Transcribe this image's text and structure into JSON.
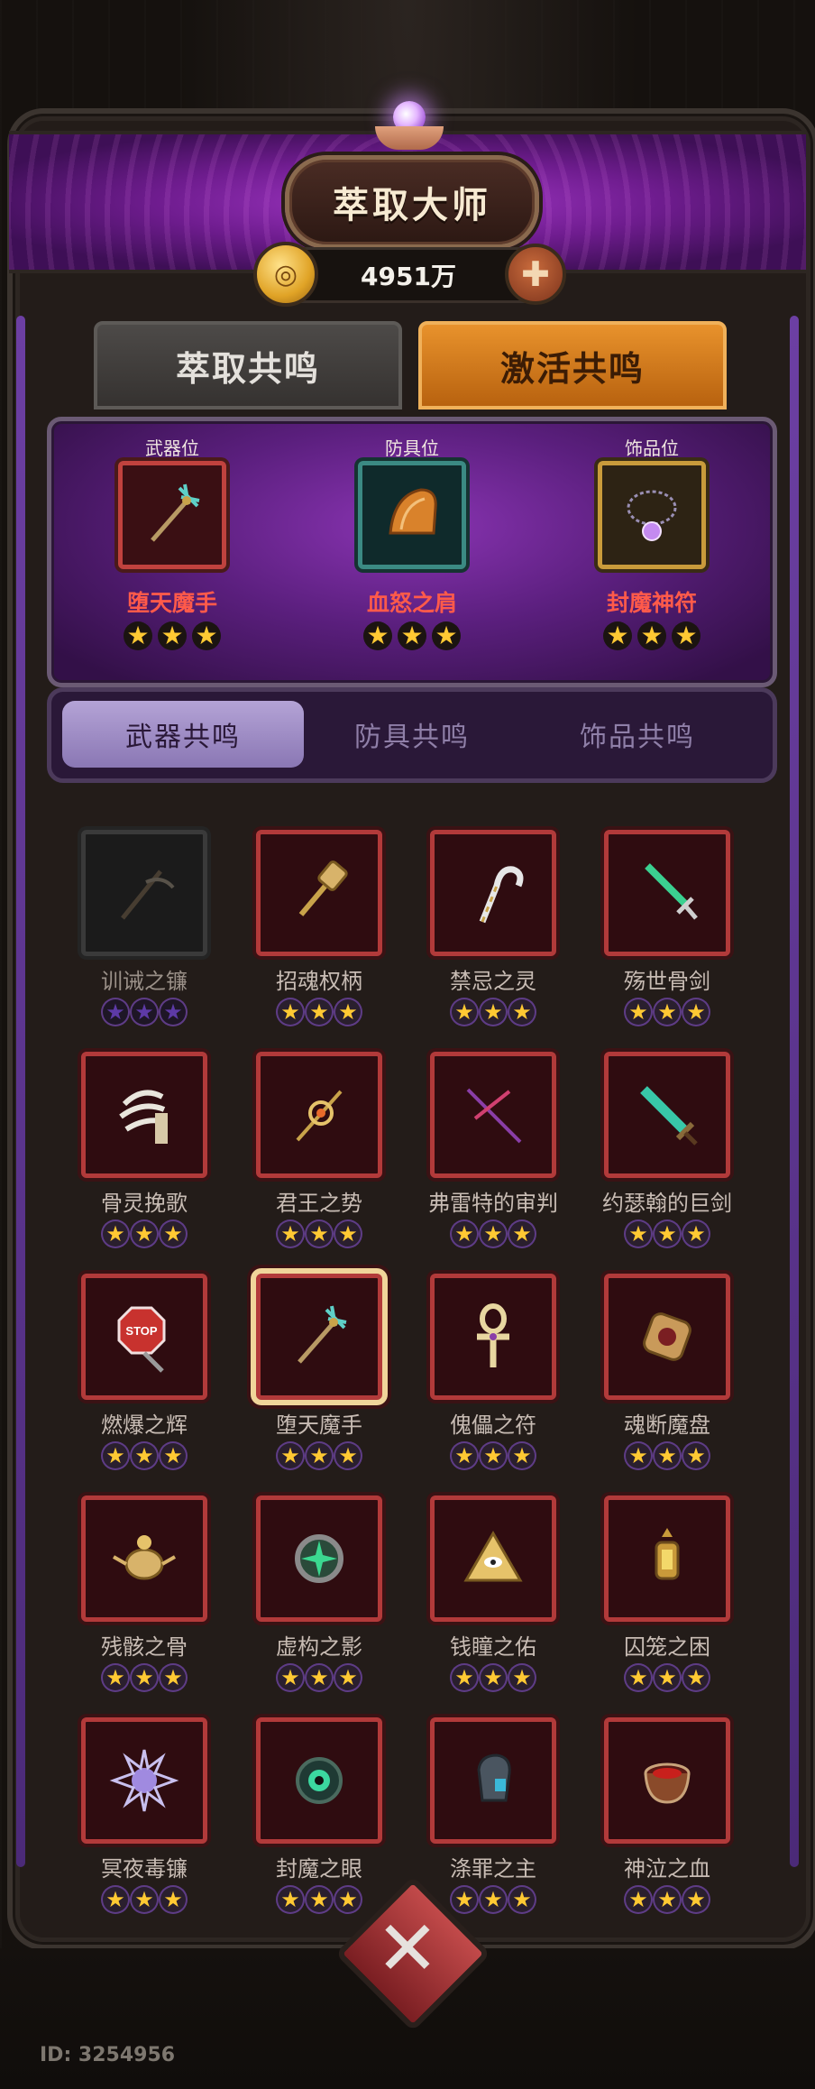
{
  "header": {
    "title": "萃取大师",
    "currency_amount": "4951万",
    "coin_icon": "coin-icon",
    "plus_icon": "plus-icon"
  },
  "main_tabs": [
    {
      "label": "萃取共鸣",
      "active": false
    },
    {
      "label": "激活共鸣",
      "active": true
    }
  ],
  "equipped": [
    {
      "slot_label": "武器位",
      "name": "堕天魔手",
      "stars": 3,
      "frame": "red",
      "icon": "trident-staff-icon"
    },
    {
      "slot_label": "防具位",
      "name": "血怒之肩",
      "stars": 3,
      "frame": "teal",
      "icon": "shoulder-armor-icon"
    },
    {
      "slot_label": "饰品位",
      "name": "封魔神符",
      "stars": 3,
      "frame": "gold",
      "icon": "amulet-icon"
    }
  ],
  "sub_tabs": [
    {
      "label": "武器共鸣",
      "active": true
    },
    {
      "label": "防具共鸣",
      "active": false
    },
    {
      "label": "饰品共鸣",
      "active": false
    }
  ],
  "weapons": [
    {
      "name": "训诫之镰",
      "stars": 3,
      "locked": true,
      "icon": "scythe-icon"
    },
    {
      "name": "招魂权柄",
      "stars": 3,
      "icon": "scepter-icon"
    },
    {
      "name": "禁忌之灵",
      "stars": 3,
      "icon": "cane-icon"
    },
    {
      "name": "殇世骨剑",
      "stars": 3,
      "icon": "bone-sword-icon"
    },
    {
      "name": "骨灵挽歌",
      "stars": 3,
      "icon": "bone-claw-icon"
    },
    {
      "name": "君王之势",
      "stars": 3,
      "icon": "royal-staff-icon"
    },
    {
      "name": "弗雷特的审判",
      "stars": 3,
      "icon": "cross-spear-icon"
    },
    {
      "name": "约瑟翰的巨剑",
      "stars": 3,
      "icon": "greatsword-icon"
    },
    {
      "name": "燃爆之辉",
      "stars": 3,
      "icon": "stop-sign-icon",
      "sign_text": "STOP"
    },
    {
      "name": "堕天魔手",
      "stars": 3,
      "selected": true,
      "icon": "trident-staff-icon"
    },
    {
      "name": "傀儡之符",
      "stars": 3,
      "icon": "ankh-icon"
    },
    {
      "name": "魂断魔盘",
      "stars": 3,
      "icon": "disc-icon"
    },
    {
      "name": "残骸之骨",
      "stars": 3,
      "icon": "scarab-icon"
    },
    {
      "name": "虚构之影",
      "stars": 3,
      "icon": "green-orb-icon"
    },
    {
      "name": "钱瞳之佑",
      "stars": 3,
      "icon": "eye-pyramid-icon"
    },
    {
      "name": "囚笼之困",
      "stars": 3,
      "icon": "lantern-icon"
    },
    {
      "name": "冥夜毒镰",
      "stars": 3,
      "icon": "spiked-orb-icon"
    },
    {
      "name": "封魔之眼",
      "stars": 3,
      "icon": "seal-eye-icon"
    },
    {
      "name": "涤罪之主",
      "stars": 3,
      "icon": "gauntlet-icon"
    },
    {
      "name": "神泣之血",
      "stars": 3,
      "icon": "blood-bowl-icon"
    }
  ],
  "footer": {
    "id_text": "ID: 3254956",
    "close_icon": "close-icon"
  },
  "colors": {
    "accent_orange": "#e8922c",
    "accent_purple": "#8a34b3",
    "item_name_red": "#ff5a4a",
    "star_gold": "#ffc933"
  }
}
